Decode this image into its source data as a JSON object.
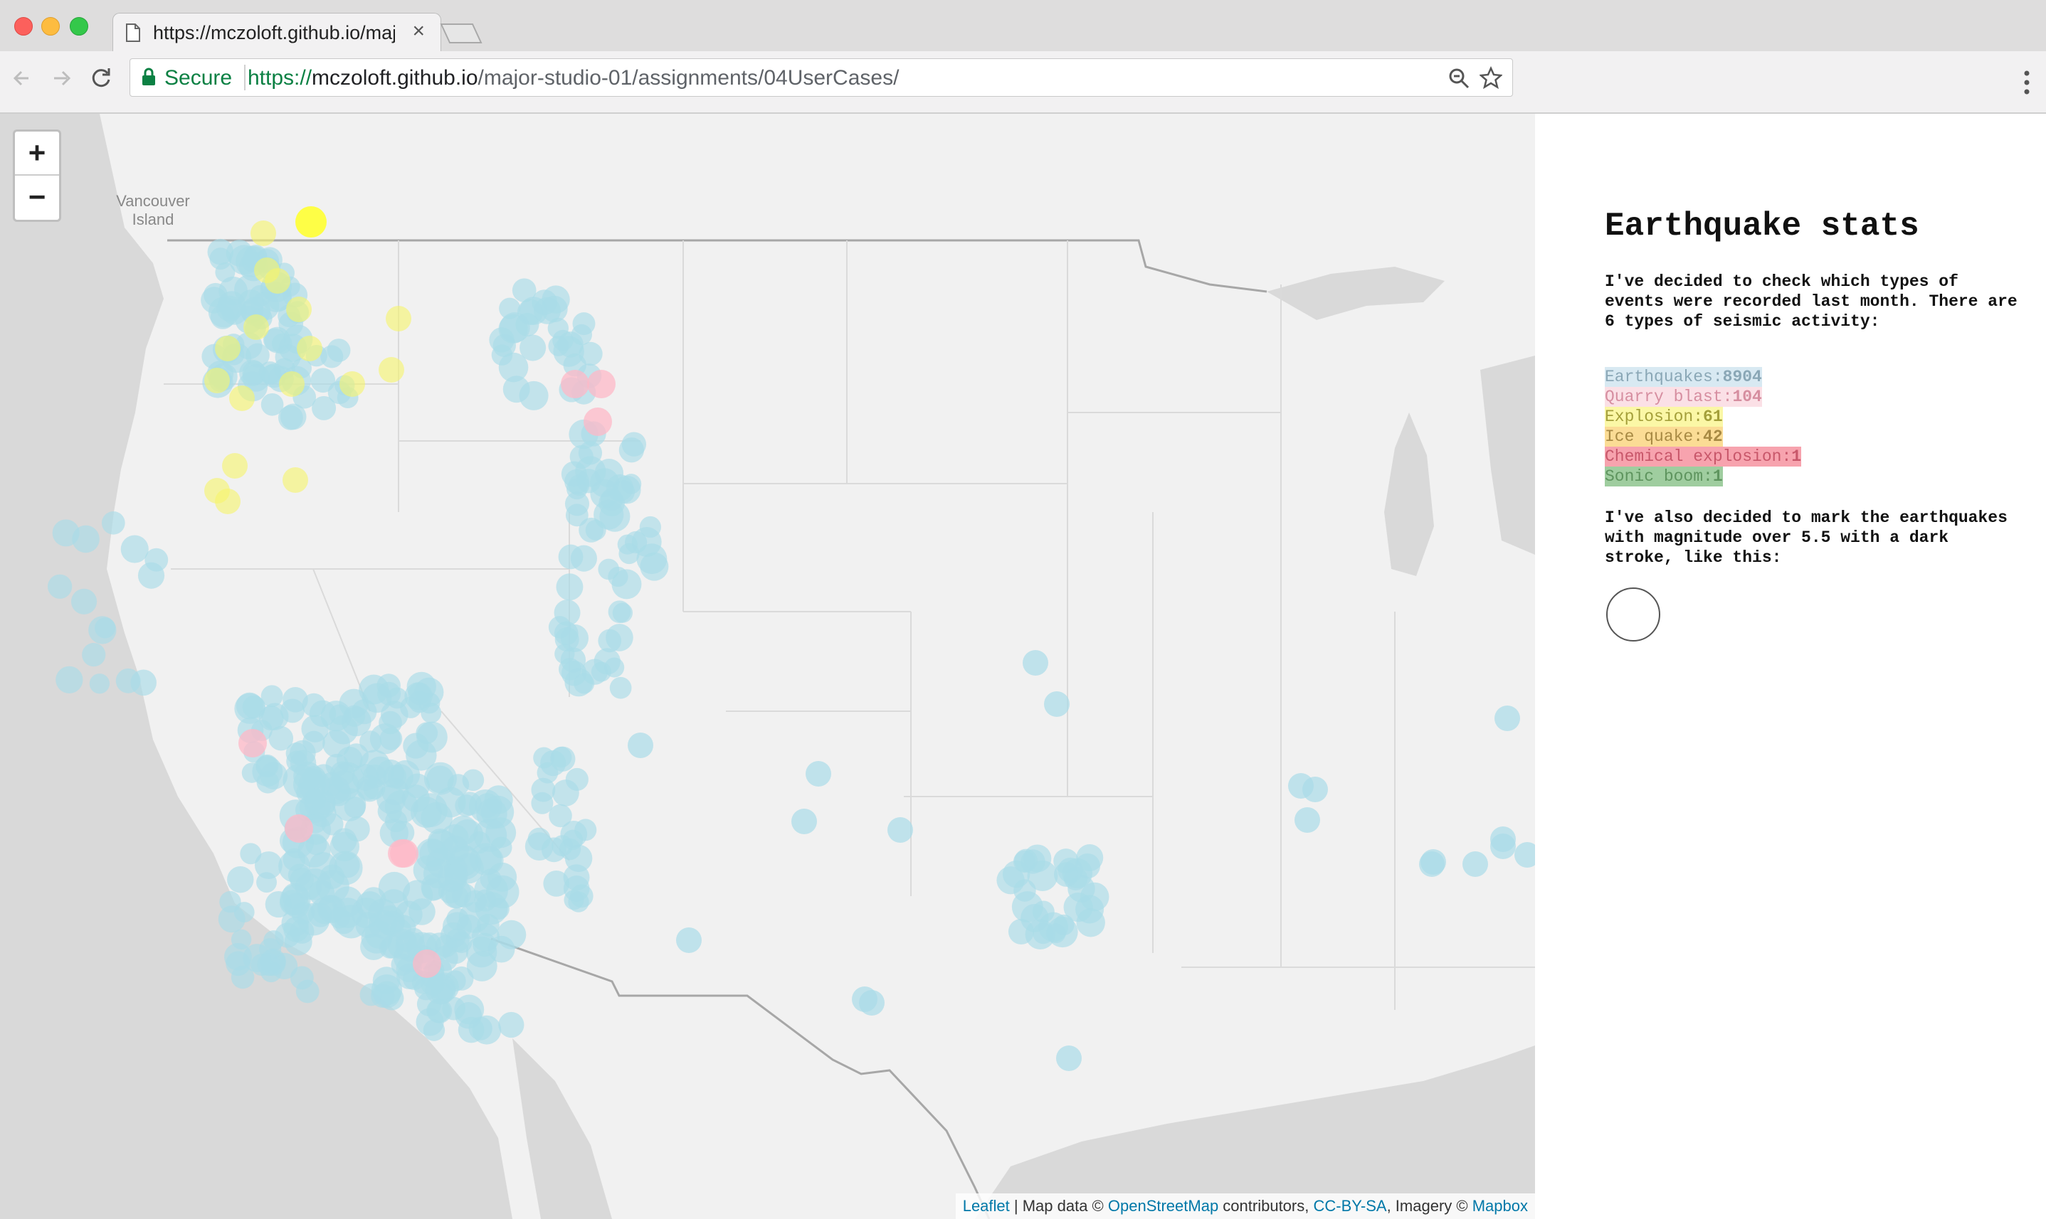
{
  "browser": {
    "tab_title": "https://mczoloft.github.io/major-studio-01/assignments/04UserCases/",
    "tab_close_glyph": "×",
    "secure_label": "Secure",
    "url_scheme": "https://",
    "url_host": "mczoloft.github.io",
    "url_path": "/major-studio-01/assignments/04UserCases/"
  },
  "map": {
    "zoom_in_label": "+",
    "zoom_out_label": "−",
    "place_label": "Vancouver Island",
    "attribution": {
      "leaflet": "Leaflet",
      "sep1": " | Map data © ",
      "osm": "OpenStreetMap",
      "sep2": " contributors, ",
      "license": "CC-BY-SA",
      "sep3": ", Imagery © ",
      "mapbox": "Mapbox"
    }
  },
  "panel": {
    "title": "Earthquake stats",
    "intro": "I've decided to check which types of events were recorded last month. There are 6 types of seismic activity:",
    "legend": [
      {
        "label": "Earthquakes: ",
        "count": "8904",
        "bg": "#d8e9f2",
        "fg": "#8aa7b6"
      },
      {
        "label": "Quarry blast: ",
        "count": "104",
        "bg": "#fbe0e6",
        "fg": "#d68ea0"
      },
      {
        "label": "Explosion: ",
        "count": "61",
        "bg": "#fbf7a6",
        "fg": "#a49f3a"
      },
      {
        "label": "Ice quake: ",
        "count": "42",
        "bg": "#fbdc95",
        "fg": "#a88a44"
      },
      {
        "label": "Chemical explosion: ",
        "count": "1",
        "bg": "#f7a3ae",
        "fg": "#c8576a"
      },
      {
        "label": "Sonic boom: ",
        "count": "1",
        "bg": "#9fcd9f",
        "fg": "#5e945e"
      }
    ],
    "outro": "I've also decided to mark the earthquakes with magnitude over 5.5 with a dark stroke, like this:"
  },
  "colors": {
    "earthquake": "#a9dbe8",
    "quarry_blast": "#fdb8c7",
    "explosion": "#f6f56a",
    "explosion_bright": "#ffff33",
    "land": "#f1f1f1",
    "water": "#d7d7d7",
    "border": "#a7a7a7"
  }
}
